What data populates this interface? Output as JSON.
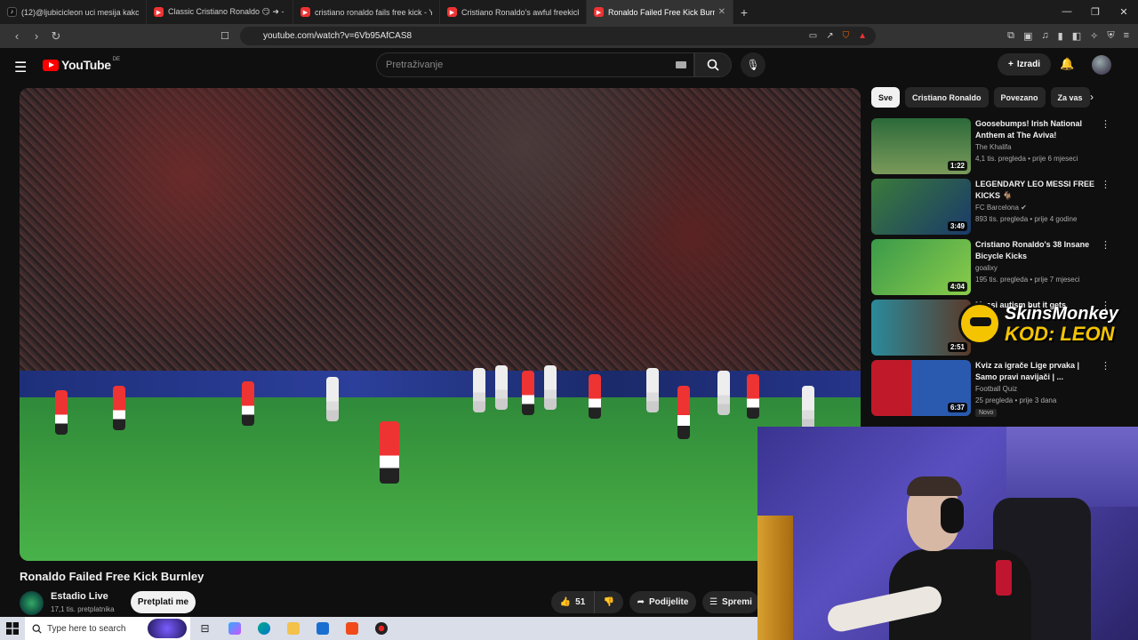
{
  "browser": {
    "tabs": [
      {
        "label": "(12)@ljubicicleon uci mesija kako da",
        "favicon": "tiktok"
      },
      {
        "label": "Classic Cristiano Ronaldo 😏 ➜ - You",
        "favicon": "youtube"
      },
      {
        "label": "cristiano ronaldo fails free kick - YouT",
        "favicon": "youtube"
      },
      {
        "label": "Cristiano Ronaldo's awful freekicks ag",
        "favicon": "youtube"
      },
      {
        "label": "Ronaldo Failed Free Kick Burnl",
        "favicon": "youtube",
        "active": true
      }
    ],
    "new_tab": "+",
    "url": "youtube.com/watch?v=6Vb95AfCAS8"
  },
  "youtube": {
    "logo_text": "YouTube",
    "country_code": "DE",
    "search_placeholder": "Pretraživanje",
    "create_label": "Izradi",
    "video": {
      "title": "Ronaldo Failed Free Kick Burnley",
      "channel": "Estadio Live",
      "subscribers": "17,1 tis. pretplatnika",
      "subscribe_label": "Pretplati me",
      "likes": "51",
      "share_label": "Podijelite",
      "save_label": "Spremi"
    },
    "chips": [
      "Sve",
      "Cristiano Ronaldo",
      "Povezano",
      "Za vas"
    ],
    "recommendations": [
      {
        "title": "Goosebumps! Irish National Anthem at The Aviva!",
        "channel": "The Khalifa",
        "meta": "4,1 tis. pregleda • prije 6 mjeseci",
        "duration": "1:22",
        "colors": [
          "#2c6a3a",
          "#7a9a5a"
        ]
      },
      {
        "title": "LEGENDARY LEO MESSI FREE KICKS 🐐",
        "channel": "FC Barcelona ✔",
        "meta": "893 tis. pregleda • prije 4 godine",
        "duration": "3:49",
        "colors": [
          "#3a7a3a",
          "#1a3a6a"
        ]
      },
      {
        "title": "Cristiano Ronaldo's 38 Insane Bicycle Kicks",
        "channel": "goalixy",
        "meta": "195 tis. pregleda • prije 7 mjeseci",
        "duration": "4:04",
        "colors": [
          "#3a9a4a",
          "#8acc4a"
        ]
      },
      {
        "title": "Messi autism but it gets",
        "channel": "",
        "meta": "",
        "duration": "2:51",
        "colors": [
          "#2a8a9a",
          "#5a3a2a"
        ]
      },
      {
        "title": "Kviz za igrače Lige prvaka | Samo pravi navijači | ...",
        "channel": "Football Quiz",
        "meta": "25 pregleda • prije 3 dana",
        "duration": "6:37",
        "badge": "Novo",
        "colors": [
          "#c01a2a",
          "#2a5ab0"
        ]
      }
    ],
    "sponsor": {
      "line1": "SkinsMonkey",
      "line2": "KOD: LEON"
    }
  },
  "taskbar": {
    "search_placeholder": "Type here to search"
  }
}
